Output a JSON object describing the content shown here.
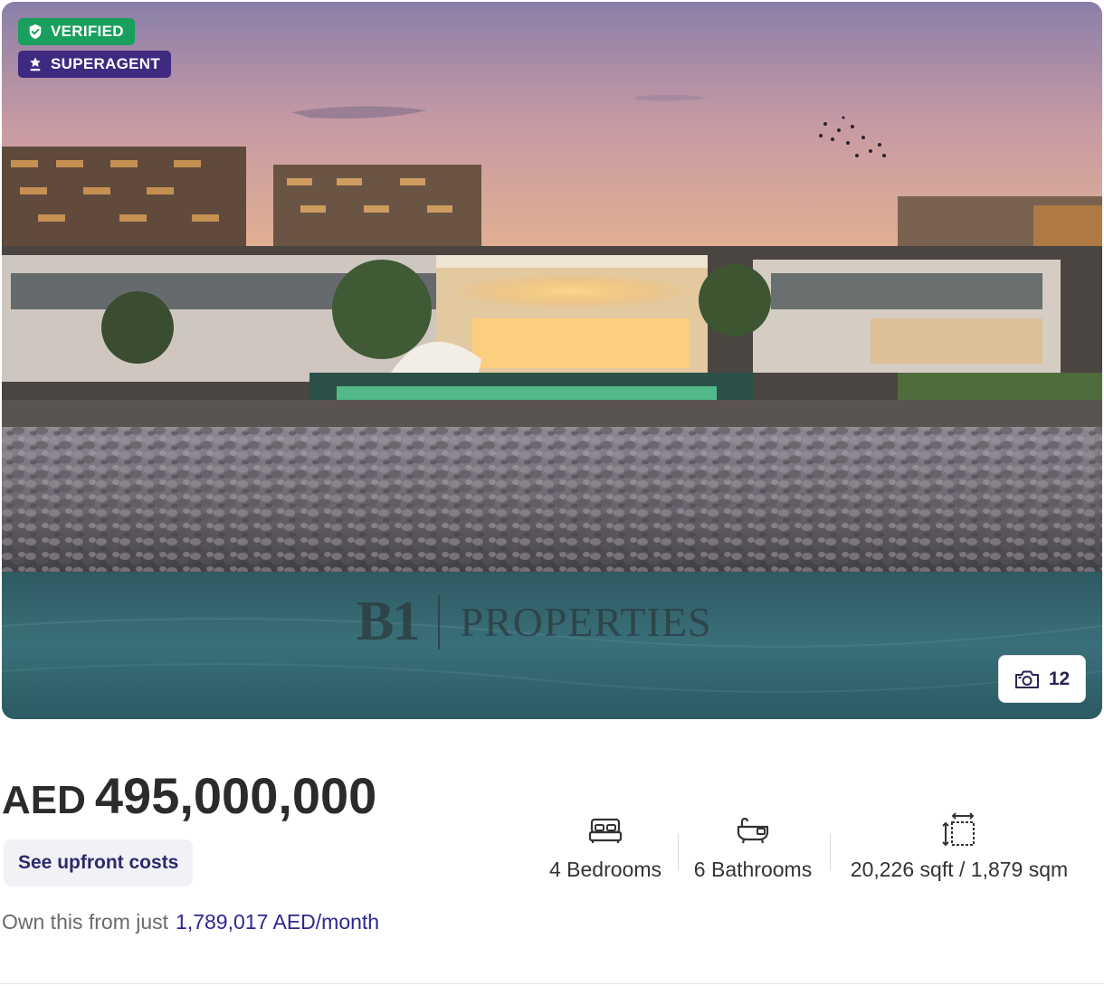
{
  "hero": {
    "badges": {
      "verified": "VERIFIED",
      "superagent": "SUPERAGENT"
    },
    "watermark": {
      "logo": "B1",
      "text": "PROPERTIES"
    },
    "photo_count": "12",
    "icons": {
      "verified": "shield-check-icon",
      "superagent": "agent-star-icon",
      "photos": "camera-icon"
    }
  },
  "price": {
    "currency": "AED",
    "amount": "495,000,000"
  },
  "upfront_costs_label": "See upfront costs",
  "mortgage": {
    "prefix": "Own this from just",
    "amount": "1,789,017 AED/month"
  },
  "features": {
    "bedrooms": {
      "label": "4 Bedrooms",
      "icon": "bed-icon"
    },
    "bathrooms": {
      "label": "6 Bathrooms",
      "icon": "bathtub-icon"
    },
    "area": {
      "label": "20,226 sqft / 1,879 sqm",
      "icon": "area-icon"
    }
  },
  "colors": {
    "verified_badge": "#1aa05e",
    "superagent_badge": "#3e2a80",
    "link": "#2b2790",
    "upfront_bg": "#f1f1f6"
  }
}
